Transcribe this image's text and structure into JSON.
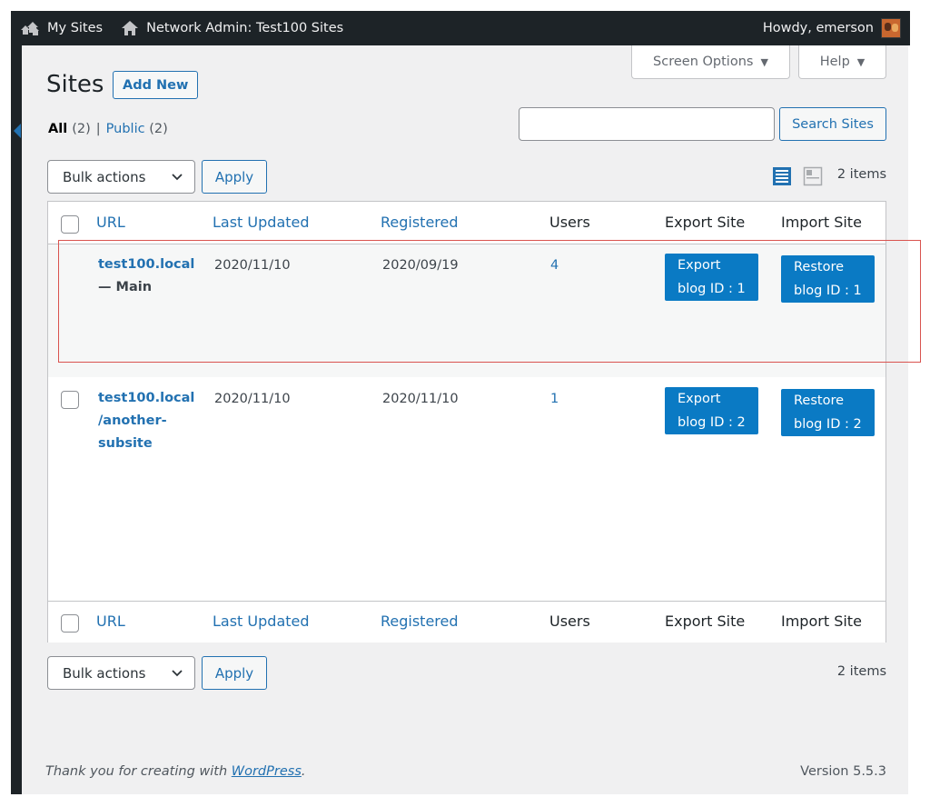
{
  "adminbar": {
    "my_sites": "My Sites",
    "network_admin": "Network Admin: Test100 Sites",
    "howdy": "Howdy, emerson"
  },
  "screen_meta": {
    "screen_options": "Screen Options",
    "help": "Help"
  },
  "page": {
    "title": "Sites",
    "add_new": "Add New"
  },
  "filters": {
    "all_label": "All",
    "all_count": "(2)",
    "separator": "|",
    "public_label": "Public",
    "public_count": "(2)"
  },
  "search": {
    "value": "",
    "button": "Search Sites"
  },
  "tablenav": {
    "bulk_label": "Bulk actions",
    "apply": "Apply",
    "items": "2 items"
  },
  "columns": {
    "url": "URL",
    "last_updated": "Last Updated",
    "registered": "Registered",
    "users": "Users",
    "export": "Export Site",
    "import": "Import Site"
  },
  "rows": [
    {
      "url_lines": [
        "test100.local"
      ],
      "subtitle": "— Main",
      "last_updated": "2020/11/10",
      "registered": "2020/09/19",
      "users": "4",
      "export_line1": "Export",
      "export_line2": "blog ID : 1",
      "restore_line1": "Restore",
      "restore_line2": "blog ID : 1"
    },
    {
      "url_lines": [
        "test100.local",
        "/another-",
        "subsite"
      ],
      "last_updated": "2020/11/10",
      "registered": "2020/11/10",
      "users": "1",
      "export_line1": "Export",
      "export_line2": "blog ID : 2",
      "restore_line1": "Restore",
      "restore_line2": "blog ID : 2"
    }
  ],
  "footer": {
    "thanks_prefix": "Thank you for creating with ",
    "wordpress_link": "WordPress",
    "thanks_suffix": ".",
    "version": "Version 5.5.3"
  },
  "colors": {
    "adminbar_bg": "#1d2327",
    "link_blue": "#2271b1",
    "action_button_blue": "#0a7ac4",
    "highlight_red": "#d9534f"
  }
}
